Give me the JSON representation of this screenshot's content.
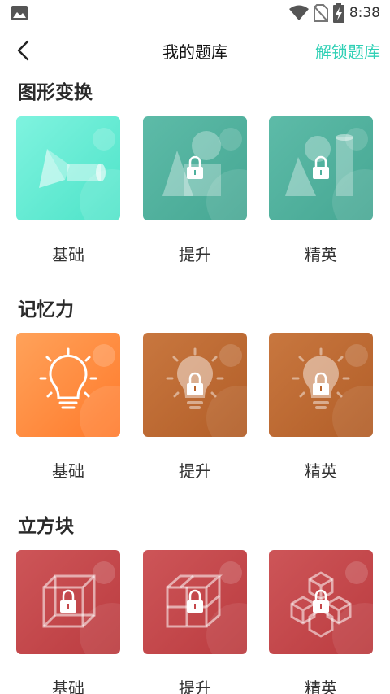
{
  "status_bar": {
    "time": "8:38",
    "icons": [
      "gallery-icon",
      "wifi-icon",
      "no-sim-icon",
      "battery-charging-icon"
    ]
  },
  "header": {
    "back_icon": "chevron-left-icon",
    "title": "我的题库",
    "unlock_label": "解锁题库",
    "accent_color": "#2fd0b5"
  },
  "sections": [
    {
      "title": "图形变换",
      "items": [
        {
          "label": "基础",
          "locked": false,
          "icon": "shapes-icon",
          "color": "#5ee8cf"
        },
        {
          "label": "提升",
          "locked": true,
          "icon": "shapes-icon",
          "color": "#4fb19e"
        },
        {
          "label": "精英",
          "locked": true,
          "icon": "shapes-icon",
          "color": "#4fb19e"
        }
      ]
    },
    {
      "title": "记忆力",
      "items": [
        {
          "label": "基础",
          "locked": false,
          "icon": "lightbulb-icon",
          "color": "#ff8a3d"
        },
        {
          "label": "提升",
          "locked": true,
          "icon": "lightbulb-icon",
          "color": "#c06a34"
        },
        {
          "label": "精英",
          "locked": true,
          "icon": "lightbulb-icon",
          "color": "#c06a34"
        }
      ]
    },
    {
      "title": "立方块",
      "items": [
        {
          "label": "基础",
          "locked": true,
          "icon": "wire-cube-icon",
          "color": "#c5474b"
        },
        {
          "label": "提升",
          "locked": true,
          "icon": "cube-grid-icon",
          "color": "#c5474b"
        },
        {
          "label": "精英",
          "locked": true,
          "icon": "stacked-cubes-icon",
          "color": "#c5474b"
        }
      ]
    }
  ]
}
